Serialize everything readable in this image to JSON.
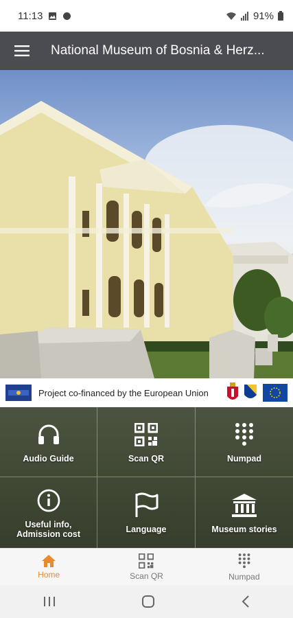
{
  "status_bar": {
    "time": "11:13",
    "battery": "91%"
  },
  "app_bar": {
    "title": "National Museum of Bosnia & Herz..."
  },
  "banner": {
    "text": "Project co-financed by the European Union"
  },
  "tiles": [
    {
      "label": "Audio Guide",
      "icon": "headphones-icon"
    },
    {
      "label": "Scan QR",
      "icon": "qr-code-icon"
    },
    {
      "label": "Numpad",
      "icon": "numpad-icon"
    },
    {
      "label": "Useful info,\nAdmission cost",
      "icon": "info-icon"
    },
    {
      "label": "Language",
      "icon": "flag-icon"
    },
    {
      "label": "Museum stories",
      "icon": "museum-icon"
    }
  ],
  "bottom_nav": [
    {
      "label": "Home",
      "icon": "home-icon",
      "active": true
    },
    {
      "label": "Scan QR",
      "icon": "qr-code-icon",
      "active": false
    },
    {
      "label": "Numpad",
      "icon": "numpad-icon",
      "active": false
    }
  ],
  "colors": {
    "appbar": "#4b4b52",
    "accent": "#e98a2c"
  }
}
